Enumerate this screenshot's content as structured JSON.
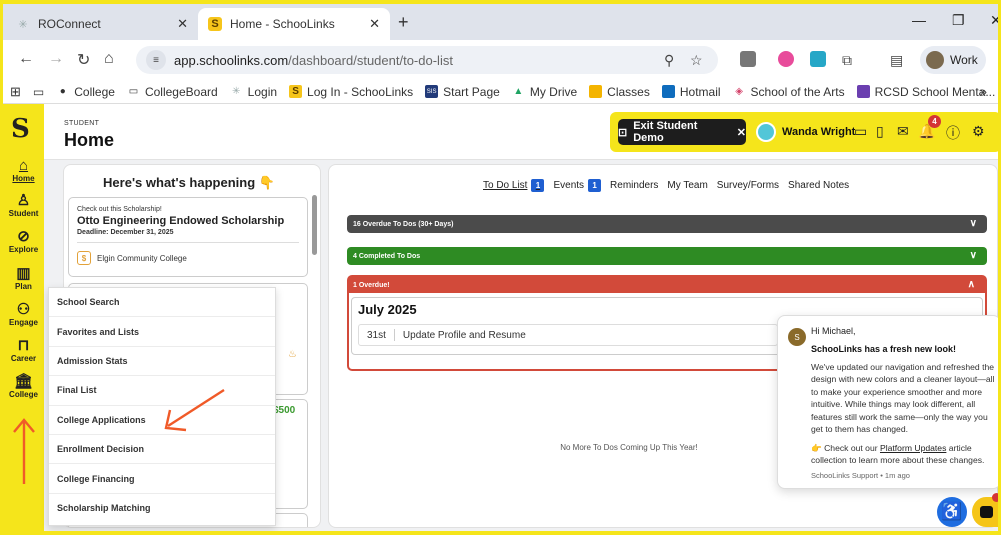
{
  "browser": {
    "tabs": [
      {
        "title": "ROConnect",
        "active": false
      },
      {
        "title": "Home - SchooLinks",
        "active": true
      }
    ],
    "url_host": "app.schoolinks.com",
    "url_path": "/dashboard/student/to-do-list",
    "profile_label": "Work",
    "bookmarks": [
      "College",
      "CollegeBoard",
      "Login",
      "Log In - SchooLinks",
      "Start Page",
      "My Drive",
      "Classes",
      "Hotmail",
      "School of the Arts",
      "RCSD School Menta..."
    ]
  },
  "nav": {
    "brand": "S",
    "items": [
      {
        "label": "Home",
        "icon": "home-icon",
        "glyph": "⌂"
      },
      {
        "label": "Student",
        "icon": "student-icon",
        "glyph": "♙"
      },
      {
        "label": "Explore",
        "icon": "compass-icon",
        "glyph": "⊘"
      },
      {
        "label": "Plan",
        "icon": "map-icon",
        "glyph": "▥"
      },
      {
        "label": "Engage",
        "icon": "handshake-icon",
        "glyph": "⚇"
      },
      {
        "label": "Career",
        "icon": "briefcase-icon",
        "glyph": "⊓"
      },
      {
        "label": "College",
        "icon": "college-icon",
        "glyph": "⌂"
      }
    ]
  },
  "header": {
    "role": "STUDENT",
    "title": "Home",
    "exit_label": "Exit Student Demo",
    "user_name": "Wanda Wright",
    "notification_count": "4"
  },
  "happenings": {
    "title": "Here's what's happening 👇",
    "card": {
      "kicker": "Check out this Scholarship!",
      "name": "Otto Engineering Endowed Scholarship",
      "deadline": "Deadline: December 31, 2025",
      "org": "Elgin Community College"
    },
    "amount": "$500"
  },
  "college_menu": [
    "School Search",
    "Favorites and Lists",
    "Admission Stats",
    "Final List",
    "College Applications",
    "Enrollment Decision",
    "College Financing",
    "Scholarship Matching"
  ],
  "main": {
    "tabs": [
      {
        "label": "To Do List",
        "count": "1"
      },
      {
        "label": "Events",
        "count": "1"
      },
      {
        "label": "Reminders"
      },
      {
        "label": "My Team"
      },
      {
        "label": "Survey/Forms"
      },
      {
        "label": "Shared Notes"
      }
    ],
    "bars": {
      "overdue_30": "16 Overdue To Dos (30+ Days)",
      "completed": "4 Completed To Dos",
      "overdue": "1 Overdue!"
    },
    "month": "July 2025",
    "todo": {
      "day": "31st",
      "title": "Update Profile and Resume"
    },
    "footer_note": "No More To Dos Coming Up This Year!"
  },
  "popup": {
    "avatar_letter": "S",
    "greeting": "Hi Michael,",
    "headline": "SchooLinks has a fresh new look!",
    "body": "We've updated our navigation and refreshed the design with new colors and a cleaner layout—all to make your experience smoother and more intuitive. While things may look different, all features still work the same—only the way you get to them has changed.",
    "cta_pre": "👉 Check out our ",
    "cta_link": "Platform Updates",
    "cta_post": " article collection to learn more about these changes.",
    "footer": "SchooLinks Support • 1m ago"
  },
  "colors": {
    "highlight": "#f5e51b",
    "overdue_30": "#4b4b4b",
    "completed": "#2e8b23",
    "overdue": "#d24a3a",
    "badge_blue": "#1f5fd1",
    "annotation": "#f05a28"
  }
}
